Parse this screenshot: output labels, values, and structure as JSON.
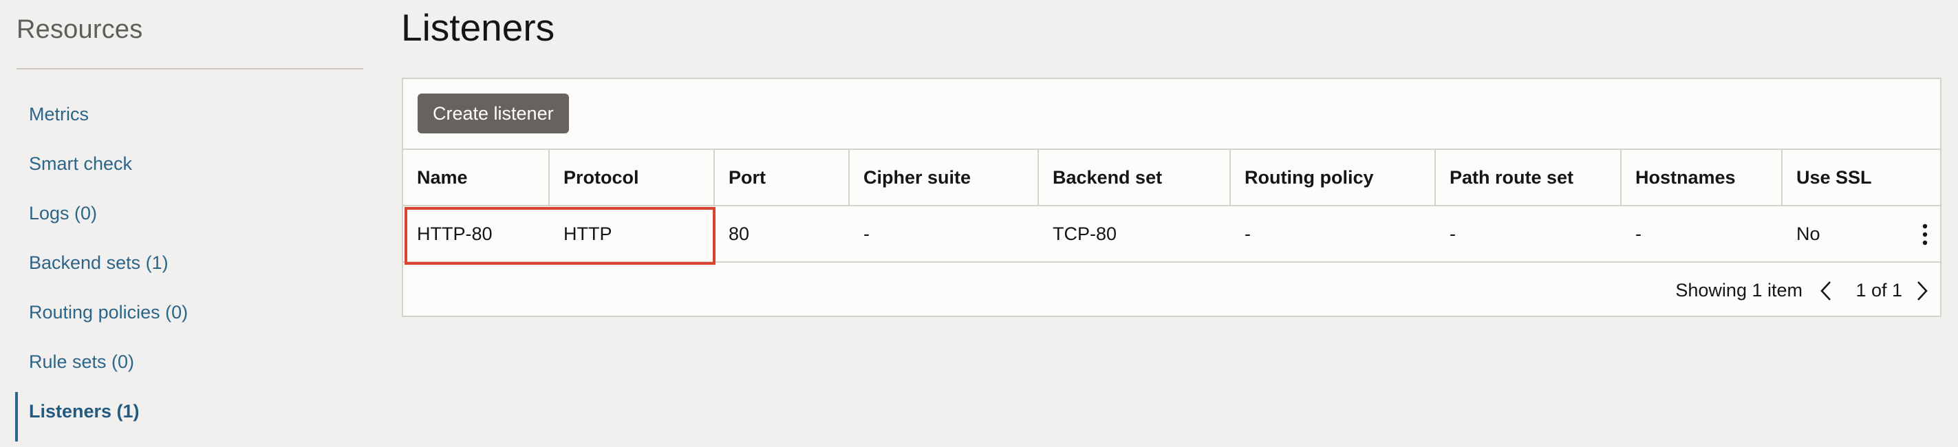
{
  "sidebar": {
    "title": "Resources",
    "items": [
      {
        "label": "Metrics"
      },
      {
        "label": "Smart check"
      },
      {
        "label": "Logs (0)"
      },
      {
        "label": "Backend sets (1)"
      },
      {
        "label": "Routing policies (0)"
      },
      {
        "label": "Rule sets (0)"
      },
      {
        "label": "Listeners (1)",
        "active": true
      }
    ]
  },
  "main": {
    "title": "Listeners",
    "create_button": "Create listener",
    "table": {
      "columns": [
        "Name",
        "Protocol",
        "Port",
        "Cipher suite",
        "Backend set",
        "Routing policy",
        "Path route set",
        "Hostnames",
        "Use SSL"
      ],
      "rows": [
        [
          "HTTP-80",
          "HTTP",
          "80",
          "-",
          "TCP-80",
          "-",
          "-",
          "-",
          "No"
        ]
      ]
    },
    "footer": {
      "showing": "Showing 1 item",
      "page": "1 of 1"
    }
  },
  "colors": {
    "link": "#2b6589",
    "button_bg": "#67625d",
    "highlight": "#d9432f"
  },
  "icons": {
    "row_actions": "kebab-menu-icon",
    "prev": "chevron-left-icon",
    "next": "chevron-right-icon"
  }
}
